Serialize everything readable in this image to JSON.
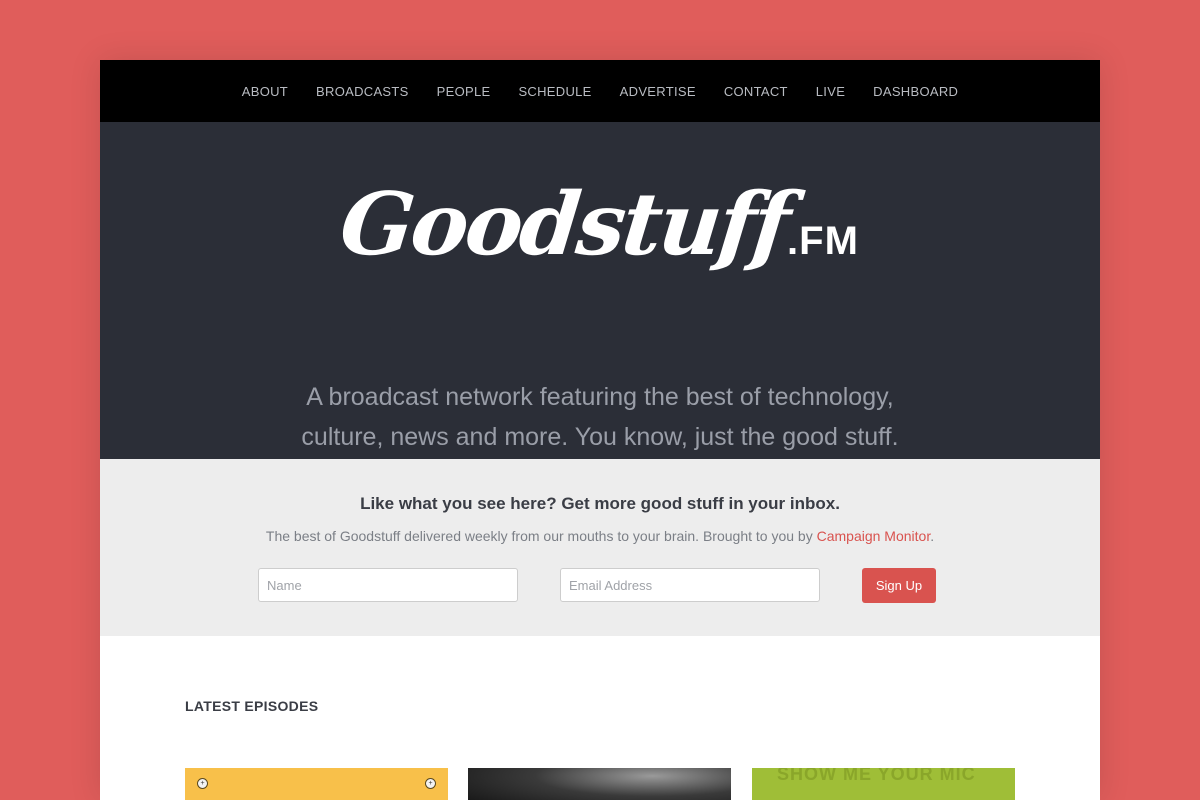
{
  "nav": {
    "items": [
      "ABOUT",
      "BROADCASTS",
      "PEOPLE",
      "SCHEDULE",
      "ADVERTISE",
      "CONTACT",
      "LIVE",
      "DASHBOARD"
    ]
  },
  "hero": {
    "logo_script": "Goodstuff",
    "logo_suffix": ".FM",
    "tagline": "A broadcast network featuring the best of technology, culture, news and more. You know, just the good stuff."
  },
  "newsletter": {
    "title": "Like what you see here? Get more good stuff in your inbox.",
    "description": "The best of Goodstuff delivered weekly from our mouths to your brain. Brought to you by ",
    "link_text": "Campaign Monitor",
    "description_end": ".",
    "name_placeholder": "Name",
    "email_placeholder": "Email Address",
    "signup_label": "Sign Up"
  },
  "episodes": {
    "heading": "LATEST EPISODES",
    "card3_text": "SHOW ME YOUR MIC"
  },
  "colors": {
    "background": "#e05d5b",
    "nav": "#000000",
    "hero": "#2b2e37",
    "newsletter": "#ededed",
    "accent": "#d9534f"
  }
}
